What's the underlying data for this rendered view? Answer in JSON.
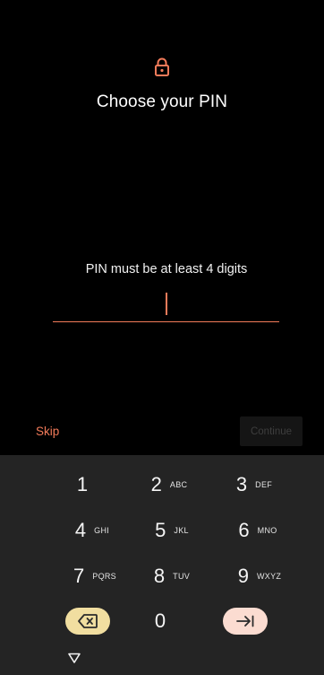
{
  "header": {
    "lock_icon": "lock-icon",
    "title": "Choose your PIN"
  },
  "pin_entry": {
    "hint": "PIN must be at least 4 digits",
    "value": ""
  },
  "actions": {
    "skip_label": "Skip",
    "continue_label": "Continue"
  },
  "keyboard": {
    "keys": [
      {
        "digit": "1",
        "letters": ""
      },
      {
        "digit": "2",
        "letters": "ABC"
      },
      {
        "digit": "3",
        "letters": "DEF"
      },
      {
        "digit": "4",
        "letters": "GHI"
      },
      {
        "digit": "5",
        "letters": "JKL"
      },
      {
        "digit": "6",
        "letters": "MNO"
      },
      {
        "digit": "7",
        "letters": "PQRS"
      },
      {
        "digit": "8",
        "letters": "TUV"
      },
      {
        "digit": "9",
        "letters": "WXYZ"
      }
    ],
    "zero": "0",
    "backspace_icon": "backspace-icon",
    "next_icon": "tab-next-icon",
    "hide_icon": "hide-keyboard-icon"
  },
  "colors": {
    "accent": "#f37b5a",
    "backspace_key": "#f1dea0",
    "next_key": "#fbdcd1",
    "keyboard_bg": "#242424"
  }
}
